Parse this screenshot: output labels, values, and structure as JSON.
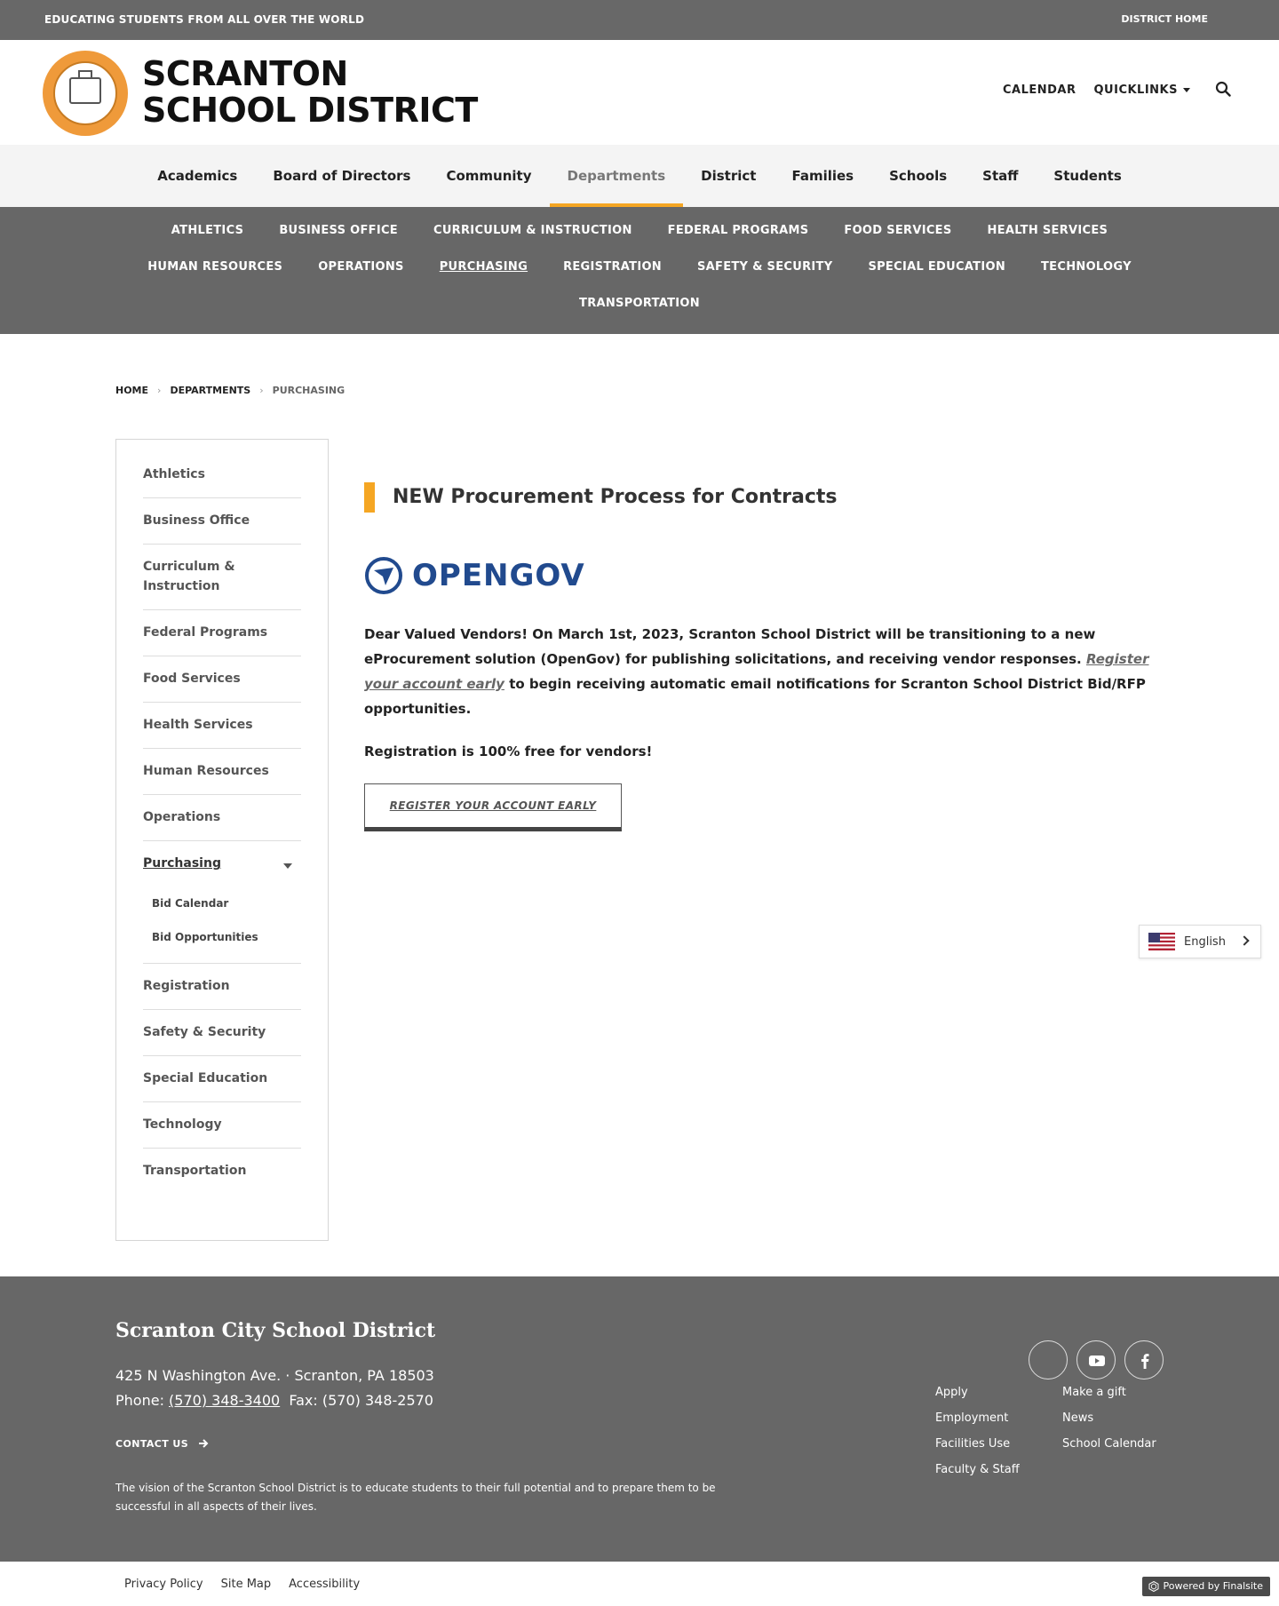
{
  "topbar": {
    "tagline": "EDUCATING STUDENTS FROM ALL OVER THE WORLD",
    "district_home": "DISTRICT HOME"
  },
  "header": {
    "logo_line1": "SCRANTON",
    "logo_line2": "SCHOOL DISTRICT",
    "calendar": "CALENDAR",
    "quicklinks": "QUICKLINKS"
  },
  "mainnav": {
    "items": [
      "Academics",
      "Board of Directors",
      "Community",
      "Departments",
      "District",
      "Families",
      "Schools",
      "Staff",
      "Students"
    ],
    "active": "Departments"
  },
  "subnav": {
    "row1": [
      "ATHLETICS",
      "BUSINESS OFFICE",
      "CURRICULUM & INSTRUCTION",
      "FEDERAL PROGRAMS",
      "FOOD SERVICES",
      "HEALTH SERVICES"
    ],
    "row2": [
      "HUMAN RESOURCES",
      "OPERATIONS",
      "PURCHASING",
      "REGISTRATION",
      "SAFETY & SECURITY",
      "SPECIAL EDUCATION",
      "TECHNOLOGY"
    ],
    "row3": [
      "TRANSPORTATION"
    ]
  },
  "breadcrumb": {
    "home": "HOME",
    "departments": "DEPARTMENTS",
    "current": "PURCHASING"
  },
  "sidebar": {
    "items": [
      "Athletics",
      "Business Office",
      "Curriculum & Instruction",
      "Federal Programs",
      "Food Services",
      "Health Services",
      "Human Resources",
      "Operations",
      "Purchasing",
      "Registration",
      "Safety & Security",
      "Special Education",
      "Technology",
      "Transportation"
    ],
    "subitems": [
      "Bid Calendar",
      "Bid Opportunities"
    ]
  },
  "content": {
    "title": "NEW Procurement Process for Contracts",
    "opengov_logo": "OPENGOV",
    "intro_part1": "Dear Valued Vendors! On March 1st, 2023, Scranton School District will be transitioning to a new eProcurement solution (OpenGov) for publishing solicitations, and receiving vendor responses. ",
    "intro_link": "Register your account early",
    "intro_part2": " to begin receiving automatic email notifications for Scranton School District Bid/RFP opportunities.",
    "free_text": "Registration is 100% free for vendors!",
    "button_label": "REGISTER YOUR ACCOUNT EARLY"
  },
  "language": {
    "label": "English"
  },
  "footer": {
    "name": "Scranton City School District",
    "address": "425 N Washington Ave.  · Scranton, PA  18503",
    "phone_label": "Phone: ",
    "phone": "(570) 348-3400",
    "fax": "Fax: (570) 348-2570",
    "contact": "CONTACT US",
    "vision": "The vision of the Scranton School District is to educate students to their full potential and to prepare them to be successful in all aspects of their lives.",
    "links_col1": [
      "Apply",
      "Employment",
      "Facilities Use",
      "Faculty & Staff"
    ],
    "links_col2": [
      "Make a gift",
      "News",
      "School Calendar"
    ]
  },
  "bottombar": {
    "privacy": "Privacy Policy",
    "sitemap": "Site Map",
    "accessibility": "Accessibility",
    "powered": "Powered by Finalsite"
  },
  "colors": {
    "accent": "#f5a623",
    "gray_bar": "#676767",
    "opengov_blue": "#214a8e"
  }
}
